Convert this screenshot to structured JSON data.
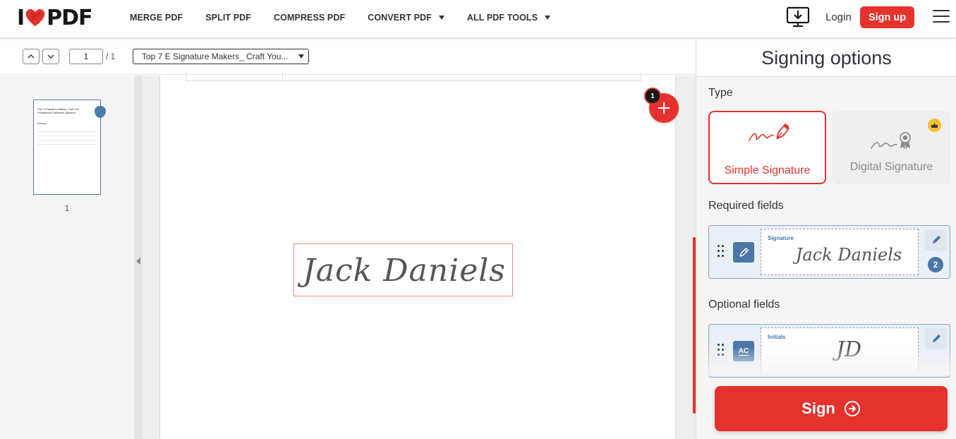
{
  "header": {
    "logo_left": "I",
    "logo_right": "PDF",
    "nav": [
      {
        "label": "MERGE PDF",
        "has_caret": false
      },
      {
        "label": "SPLIT PDF",
        "has_caret": false
      },
      {
        "label": "COMPRESS PDF",
        "has_caret": false
      },
      {
        "label": "CONVERT PDF",
        "has_caret": true
      },
      {
        "label": "ALL PDF TOOLS",
        "has_caret": true
      }
    ],
    "login": "Login",
    "signup": "Sign up",
    "icons": {
      "download": "desktop-download-icon",
      "menu": "hamburger-menu-icon"
    }
  },
  "toolbar": {
    "current_page": "1",
    "total_pages": "/ 1",
    "document_name": "Top 7 E Signature Makers_ Craft You..."
  },
  "thumbnails": {
    "items": [
      {
        "number": "1",
        "title": "Top 7 E Signature Makers: Craft Your Professional Trademark Signature",
        "section": "Overview"
      }
    ]
  },
  "document": {
    "signature_text": "Jack Daniels",
    "add_badge": "1"
  },
  "panel": {
    "title": "Signing options",
    "type_label": "Type",
    "types": [
      {
        "label": "Simple Signature",
        "active": true,
        "icon": "pen-signature-icon"
      },
      {
        "label": "Digital Signature",
        "active": false,
        "icon": "certificate-signature-icon",
        "premium": true
      }
    ],
    "required_label": "Required fields",
    "required_fields": [
      {
        "label": "Signature",
        "value": "Jack Daniels",
        "count": "2",
        "icon": "pen-icon"
      }
    ],
    "optional_label": "Optional fields",
    "optional_fields": [
      {
        "label": "Initials",
        "value": "JD",
        "icon_text": "AC"
      }
    ],
    "sign_button": "Sign"
  },
  "colors": {
    "brand_red": "#e5322d",
    "field_blue": "#4a76a8"
  }
}
